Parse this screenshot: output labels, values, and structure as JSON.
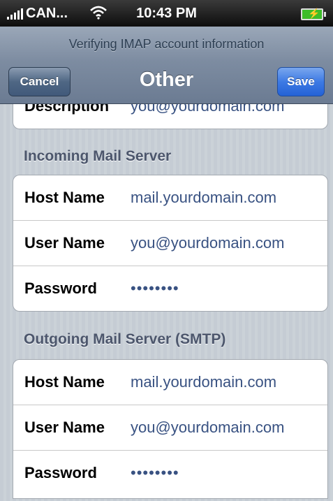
{
  "status_bar": {
    "carrier": "CAN...",
    "time": "10:43 PM"
  },
  "nav": {
    "prompt": "Verifying IMAP account information",
    "title": "Other",
    "cancel_label": "Cancel",
    "save_label": "Save"
  },
  "account": {
    "description_label": "Description",
    "description_value": "you@yourdomain.com"
  },
  "incoming": {
    "header": "Incoming Mail Server",
    "host_label": "Host Name",
    "host_value": "mail.yourdomain.com",
    "user_label": "User Name",
    "user_value": "you@yourdomain.com",
    "password_label": "Password",
    "password_value": "••••••••"
  },
  "outgoing": {
    "header": "Outgoing Mail Server (SMTP)",
    "host_label": "Host Name",
    "host_value": "mail.yourdomain.com",
    "user_label": "User Name",
    "user_value": "you@yourdomain.com",
    "password_label": "Password",
    "password_value": "••••••••"
  },
  "colors": {
    "save_button": "#2f6fe0",
    "field_value": "#395282"
  }
}
